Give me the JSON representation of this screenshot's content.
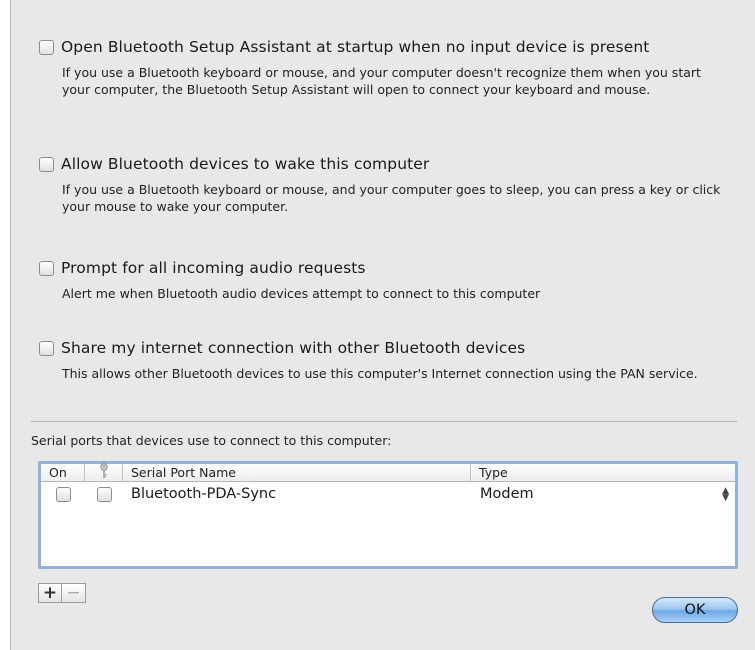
{
  "options": [
    {
      "title": "Open Bluetooth Setup Assistant at startup when no input device is present",
      "description": "If you use a Bluetooth keyboard or mouse, and your computer doesn't recognize them when you start your computer, the Bluetooth Setup Assistant will open to connect your keyboard and mouse.",
      "checked": false
    },
    {
      "title": "Allow Bluetooth devices to wake this computer",
      "description": "If you use a Bluetooth keyboard or mouse, and your computer goes to sleep, you can press a key or click your mouse to wake your computer.",
      "checked": false
    },
    {
      "title": "Prompt for all incoming audio requests",
      "description": "Alert me when Bluetooth audio devices attempt to connect to this computer",
      "checked": false
    },
    {
      "title": "Share my internet connection with other Bluetooth devices",
      "description": "This allows other Bluetooth devices to use this computer's Internet connection using the PAN service.",
      "checked": false
    }
  ],
  "serial_ports": {
    "label": "Serial ports that devices use to connect to this computer:",
    "columns": {
      "on": "On",
      "key": "key-icon",
      "name": "Serial Port Name",
      "type": "Type"
    },
    "rows": [
      {
        "on": false,
        "secure": false,
        "name": "Bluetooth-PDA-Sync",
        "type": "Modem"
      }
    ]
  },
  "buttons": {
    "add": "+",
    "remove": "−",
    "ok": "OK"
  },
  "colors": {
    "table_focus_ring": "#8db2dc",
    "ok_button": "#6ea9e4"
  }
}
